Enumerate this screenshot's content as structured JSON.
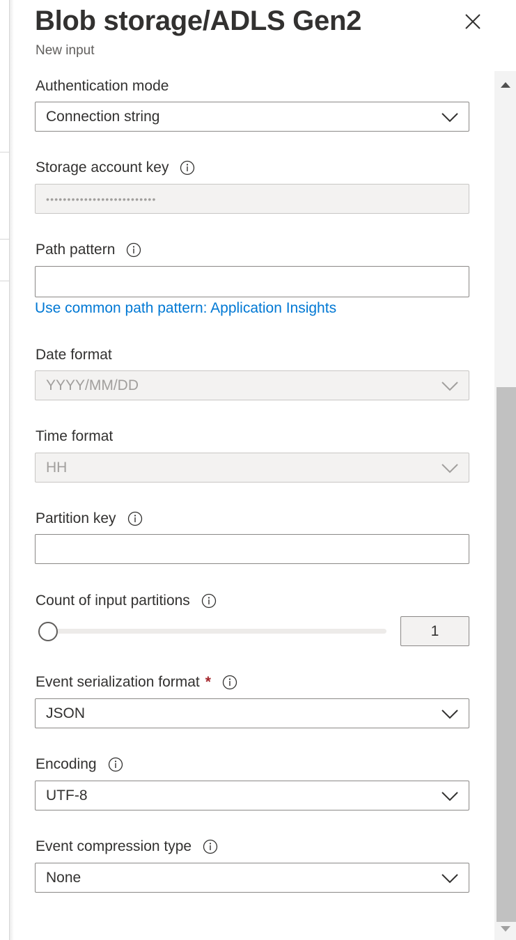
{
  "panel": {
    "title": "Blob storage/ADLS Gen2",
    "subtitle": "New input"
  },
  "fields": {
    "auth_mode": {
      "label": "Authentication mode",
      "value": "Connection string"
    },
    "storage_key": {
      "label": "Storage account key",
      "value": "••••••••••••••••••••••••••"
    },
    "path_pattern": {
      "label": "Path pattern",
      "value": "",
      "link": "Use common path pattern: Application Insights"
    },
    "date_format": {
      "label": "Date format",
      "value": "YYYY/MM/DD"
    },
    "time_format": {
      "label": "Time format",
      "value": "HH"
    },
    "partition_key": {
      "label": "Partition key",
      "value": ""
    },
    "input_partitions": {
      "label": "Count of input partitions",
      "value": "1"
    },
    "serialization": {
      "label": "Event serialization format",
      "required_mark": "*",
      "value": "JSON"
    },
    "encoding": {
      "label": "Encoding",
      "value": "UTF-8"
    },
    "compression": {
      "label": "Event compression type",
      "value": "None"
    }
  },
  "icons": {
    "close": "close-icon",
    "info": "info-icon",
    "chevron": "chevron-down-icon",
    "scroll_up": "scroll-up-arrow-icon",
    "scroll_down": "scroll-down-arrow-icon"
  },
  "colors": {
    "link": "#0078d4",
    "required": "#a4262c",
    "disabled_bg": "#f3f2f1",
    "border": "#8a8886"
  }
}
